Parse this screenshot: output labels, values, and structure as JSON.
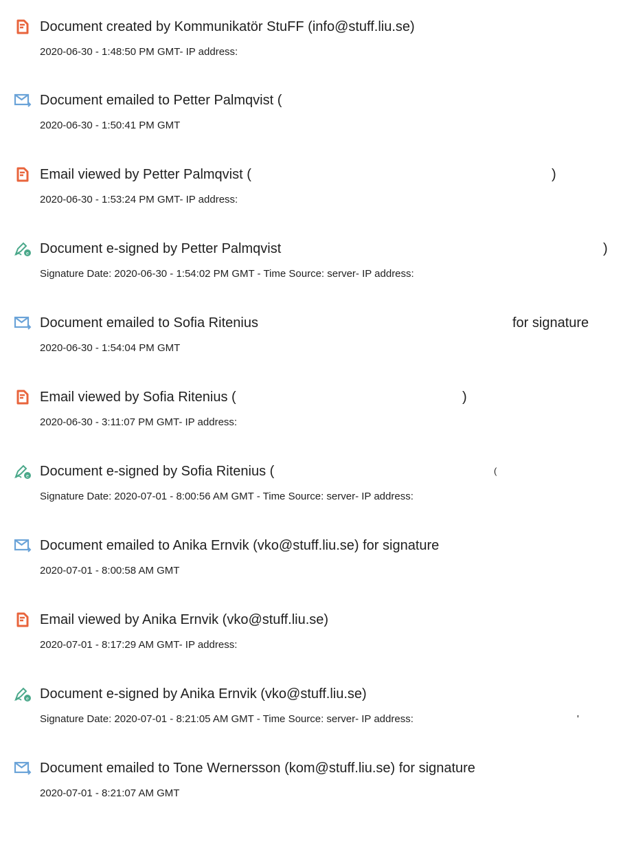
{
  "colors": {
    "document_icon": "#e8643c",
    "email_icon": "#6aa3d8",
    "sign_icon": "#4aa88a"
  },
  "entries": [
    {
      "icon": "document-icon",
      "title": "Document created by Kommunikatör StuFF (info@stuff.liu.se)",
      "meta": "2020-06-30 - 1:48:50 PM GMT- IP address:"
    },
    {
      "icon": "email-icon",
      "title": "Document emailed to Petter Palmqvist (",
      "meta": "2020-06-30 - 1:50:41 PM GMT"
    },
    {
      "icon": "document-icon",
      "title": "Email viewed by Petter Palmqvist (",
      "trail": ")",
      "meta": "2020-06-30 - 1:53:24 PM GMT- IP address:"
    },
    {
      "icon": "sign-icon",
      "title": "Document e-signed by Petter Palmqvist",
      "trail": ")",
      "meta": "Signature Date: 2020-06-30 - 1:54:02 PM GMT - Time Source: server- IP address:"
    },
    {
      "icon": "email-icon",
      "title": "Document emailed to Sofia Ritenius",
      "trail": "for signature",
      "meta": "2020-06-30 - 1:54:04 PM GMT"
    },
    {
      "icon": "document-icon",
      "title": "Email viewed by Sofia Ritenius (",
      "trail": ")",
      "meta": "2020-06-30 - 3:11:07 PM GMT- IP address:"
    },
    {
      "icon": "sign-icon",
      "title": "Document e-signed by Sofia Ritenius (",
      "trail": "(",
      "meta": "Signature Date: 2020-07-01 - 8:00:56 AM GMT - Time Source: server- IP address:"
    },
    {
      "icon": "email-icon",
      "title": "Document emailed to Anika Ernvik (vko@stuff.liu.se) for signature",
      "meta": "2020-07-01 - 8:00:58 AM GMT"
    },
    {
      "icon": "document-icon",
      "title": "Email viewed by Anika Ernvik (vko@stuff.liu.se)",
      "meta": "2020-07-01 - 8:17:29 AM GMT- IP address:"
    },
    {
      "icon": "sign-icon",
      "title": "Document e-signed by Anika Ernvik (vko@stuff.liu.se)",
      "meta": "Signature Date: 2020-07-01 - 8:21:05 AM GMT - Time Source: server- IP address:",
      "meta_trail": "'"
    },
    {
      "icon": "email-icon",
      "title": "Document emailed to Tone Wernersson (kom@stuff.liu.se) for signature",
      "meta": "2020-07-01 - 8:21:07 AM GMT"
    }
  ]
}
